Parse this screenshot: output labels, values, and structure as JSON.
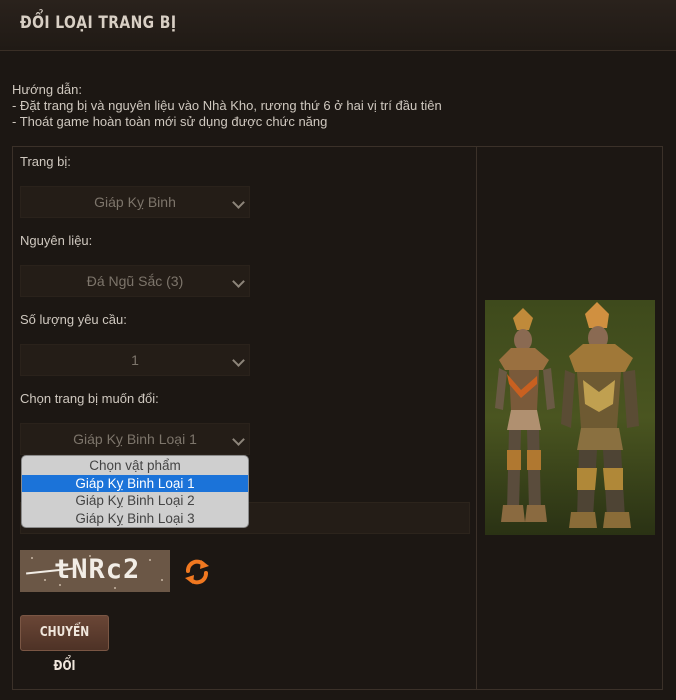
{
  "header": {
    "title": "ĐỔI LOẠI TRANG BỊ"
  },
  "guide": {
    "title": "Hướng dẫn:",
    "lines": [
      "- Đặt trang bị và nguyên liệu vào Nhà Kho, rương thứ 6 ở hai vị trí đầu tiên",
      "- Thoát game hoàn toàn mới sử dụng được chức năng"
    ]
  },
  "form": {
    "equip_label": "Trang bị:",
    "equip_value": "Giáp Kỵ Binh",
    "material_label": "Nguyên liệu:",
    "material_value": "Đá Ngũ Sắc (3)",
    "quantity_label": "Số lượng yêu cầu:",
    "quantity_value": "1",
    "target_label": "Chọn trang bị muốn đổi:",
    "target_value": "Giáp Kỵ Binh Loại 1",
    "options": [
      "Chọn vật phẩm",
      "Giáp Kỵ Binh Loại 1",
      "Giáp Kỵ Binh Loại 2",
      "Giáp Kỵ Binh Loại 3"
    ],
    "selected_option_index": 1
  },
  "captcha": {
    "text": "tNRc2"
  },
  "submit": {
    "label": "CHUYỂN ĐỔI"
  },
  "colors": {
    "accent": "#1b73d9",
    "refresh_icon": "#f07820"
  }
}
